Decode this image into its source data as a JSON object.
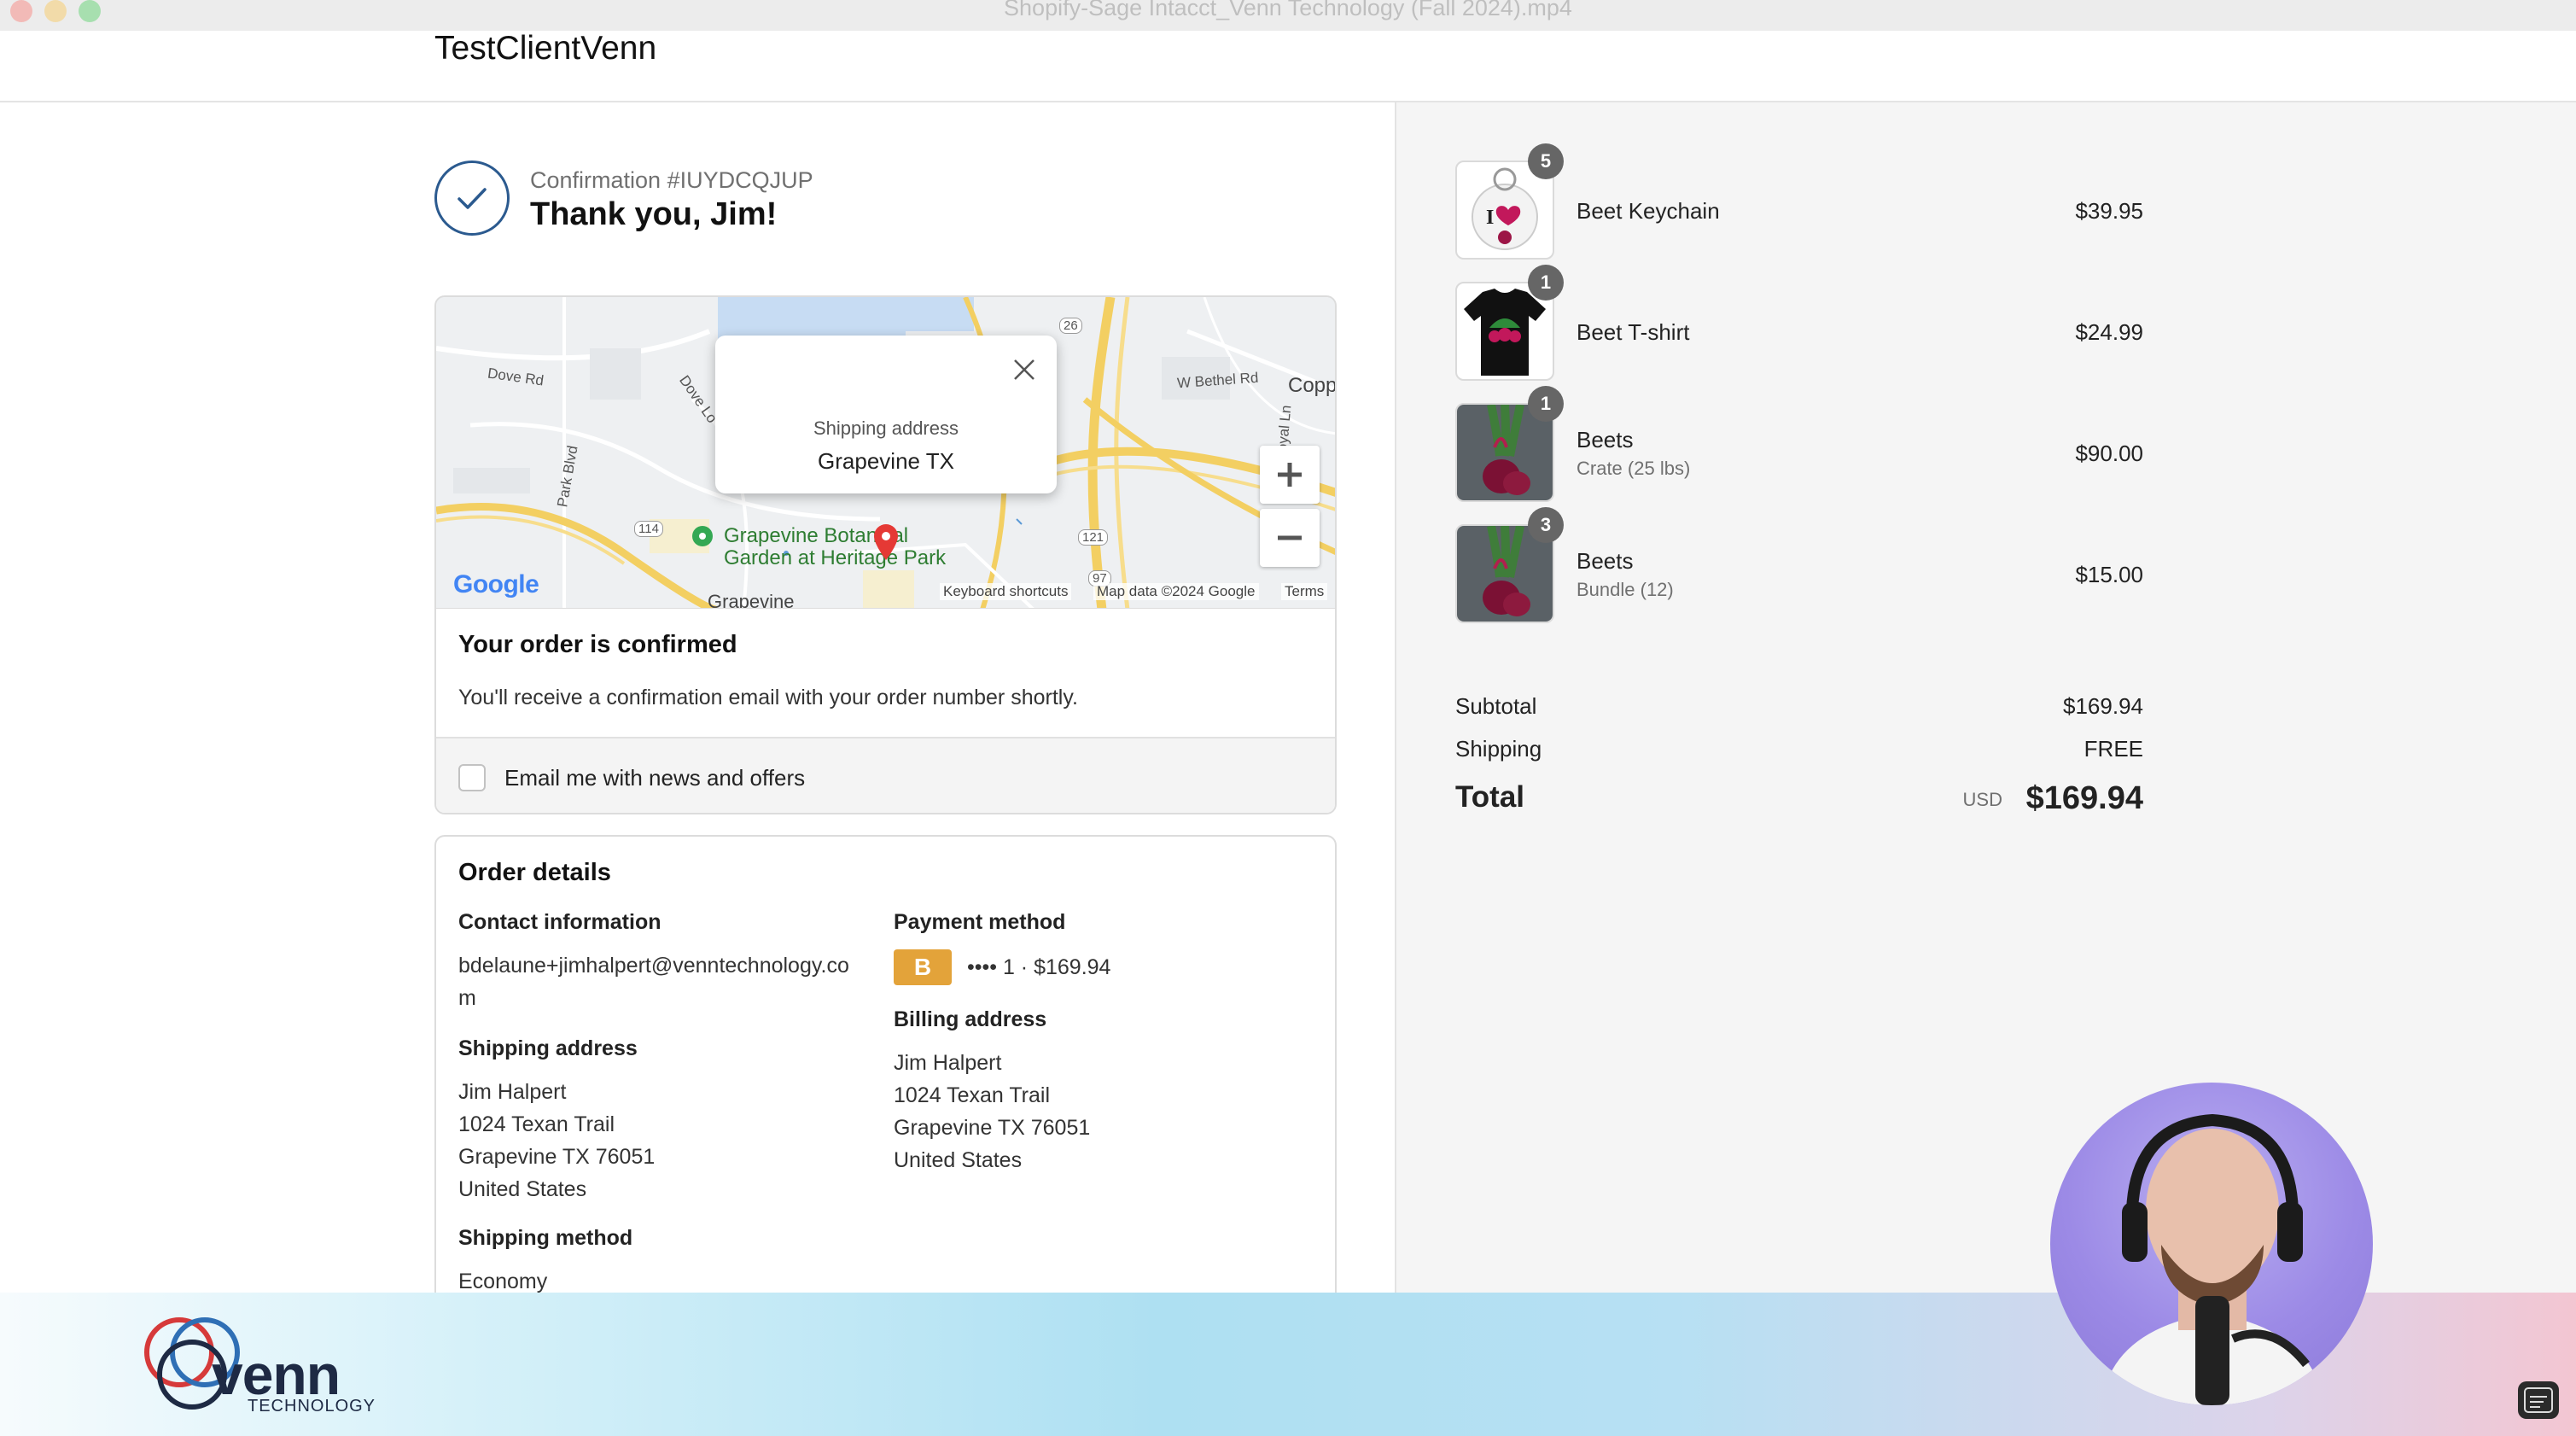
{
  "window": {
    "title": "Shopify-Sage Intacct_Venn Technology (Fall 2024).mp4"
  },
  "store": {
    "name": "TestClientVenn"
  },
  "confirmation": {
    "number": "Confirmation #IUYDCQJUP",
    "thanks": "Thank you, Jim!"
  },
  "map": {
    "popup_label": "Shipping address",
    "popup_value": "Grapevine TX",
    "labels": {
      "dove_rd": "Dove Rd",
      "dove_ln": "Dove Lo",
      "park_blvd": "Park Blvd",
      "w_bethel": "W Bethel Rd",
      "royal_ln": "Royal Ln",
      "copp": "Copp",
      "hwy26": "26",
      "hwy114": "114",
      "hwy121": "121",
      "hwy97": "97",
      "garden": "Grapevine Botanical",
      "garden2": "Garden at Heritage Park",
      "grapevine": "Grapevine"
    },
    "google_logo": "Google",
    "keyboard_shortcuts": "Keyboard shortcuts",
    "map_data": "Map data ©2024 Google",
    "terms": "Terms"
  },
  "order_confirmed": {
    "heading": "Your order is confirmed",
    "message": "You'll receive a confirmation email with your order number shortly.",
    "news_checkbox_label": "Email me with news and offers",
    "news_checked": false
  },
  "order_details": {
    "heading": "Order details",
    "contact_heading": "Contact information",
    "contact_email_line1": "bdelaune+jimhalpert@venntechnology.co",
    "contact_email_line2": "m",
    "payment_heading": "Payment method",
    "payment_badge": "B",
    "payment_text": "•••• 1 · $169.94",
    "shipping_address_heading": "Shipping address",
    "shipping_address": [
      "Jim Halpert",
      "1024 Texan Trail",
      "Grapevine TX 76051",
      "United States"
    ],
    "billing_address_heading": "Billing address",
    "billing_address": [
      "Jim Halpert",
      "1024 Texan Trail",
      "Grapevine TX 76051",
      "United States"
    ],
    "shipping_method_heading": "Shipping method",
    "shipping_method": "Economy"
  },
  "summary": {
    "items": [
      {
        "name": "Beet Keychain",
        "variant": "",
        "quantity": "5",
        "price": "$39.95",
        "thumb": "keychain"
      },
      {
        "name": "Beet T-shirt",
        "variant": "",
        "quantity": "1",
        "price": "$24.99",
        "thumb": "tshirt"
      },
      {
        "name": "Beets",
        "variant": "Crate (25 lbs)",
        "quantity": "1",
        "price": "$90.00",
        "thumb": "beets"
      },
      {
        "name": "Beets",
        "variant": "Bundle (12)",
        "quantity": "3",
        "price": "$15.00",
        "thumb": "beets"
      }
    ],
    "subtotal_label": "Subtotal",
    "subtotal_value": "$169.94",
    "shipping_label": "Shipping",
    "shipping_value": "FREE",
    "total_label": "Total",
    "total_currency": "USD",
    "total_value": "$169.94"
  },
  "branding": {
    "logo_word": "venn",
    "logo_sub": "TECHNOLOGY"
  },
  "colors": {
    "accent_check": "#2b5a8f",
    "payment_badge": "#e3a33a",
    "map_pin": "#e53935"
  }
}
